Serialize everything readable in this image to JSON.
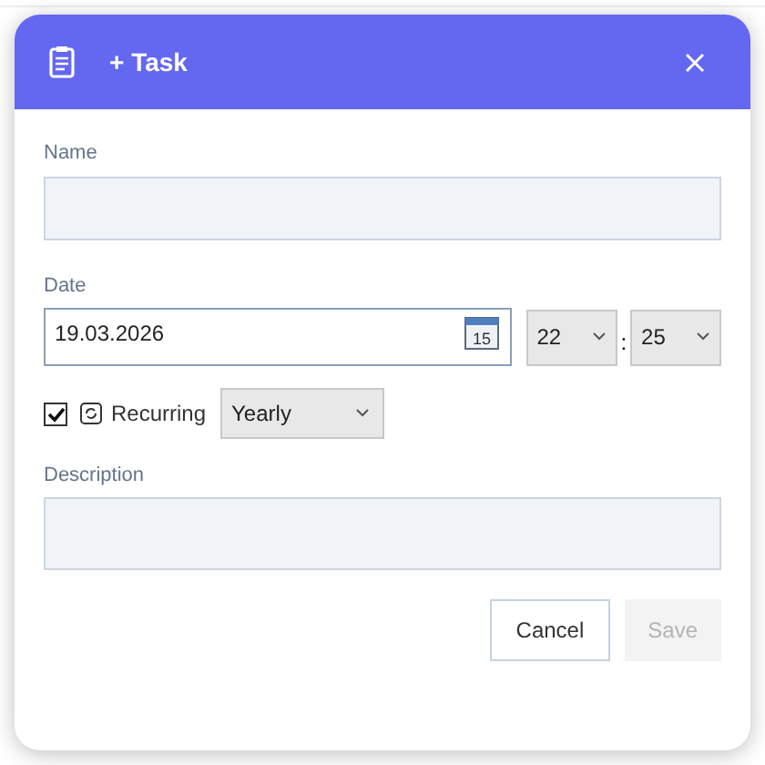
{
  "dialog": {
    "title": "+ Task",
    "name": {
      "label": "Name"
    },
    "date": {
      "label": "Date",
      "value": "19.03.2026",
      "calendar_day": "15",
      "hour": "22",
      "separator": ":",
      "minute": "25"
    },
    "recurring": {
      "label": "Recurring",
      "checked": true,
      "frequency": "Yearly"
    },
    "description": {
      "label": "Description"
    },
    "buttons": [
      {
        "label": "Cancel",
        "disabled": false
      },
      {
        "label": "Save",
        "disabled": true
      }
    ]
  }
}
